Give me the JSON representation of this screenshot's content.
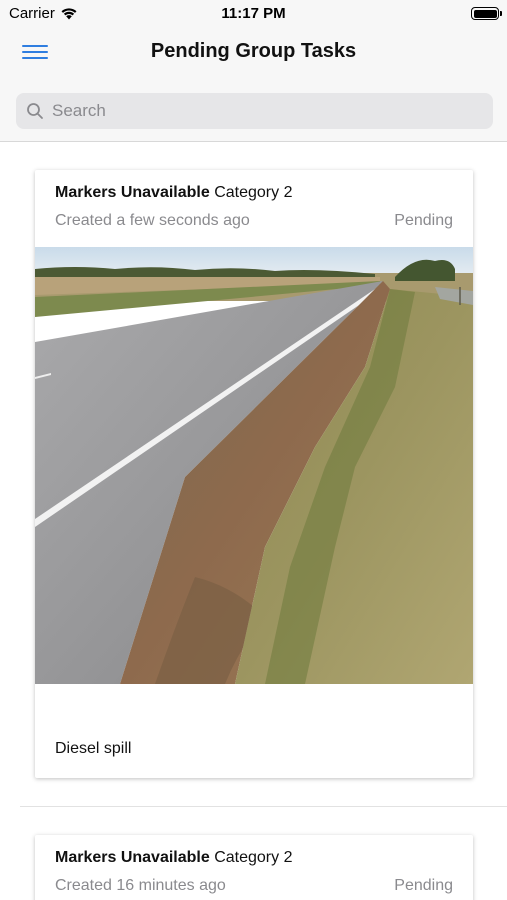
{
  "status_bar": {
    "carrier": "Carrier",
    "time": "11:17 PM"
  },
  "nav": {
    "title": "Pending Group Tasks",
    "menu_icon": "hamburger-menu-icon"
  },
  "search": {
    "placeholder": "Search",
    "value": "",
    "icon": "search-icon"
  },
  "tasks": [
    {
      "title": "Markers Unavailable",
      "category": "Category 2",
      "created": "Created a few seconds ago",
      "status": "Pending",
      "photo": "roadside-shoulder-photo",
      "description": "Diesel spill"
    },
    {
      "title": "Markers Unavailable",
      "category": "Category 2",
      "created": "Created 16 minutes ago",
      "status": "Pending"
    }
  ],
  "colors": {
    "accent": "#2f7ee0",
    "secondary_text": "#8a8a8e",
    "bar_background": "#f7f7f7"
  }
}
